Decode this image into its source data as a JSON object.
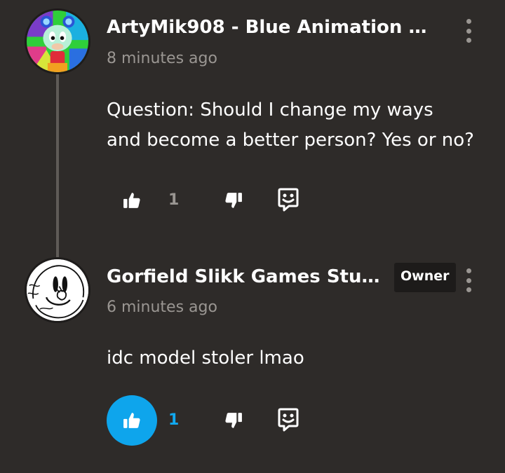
{
  "comments": [
    {
      "author": "ArtyMik908 - Blue Animation",
      "handle": "@...",
      "time": "8 minutes ago",
      "body_line1": "Question: Should I change my ways",
      "body_line2": "and become a better person? Yes or no?",
      "likes": "1",
      "liked": false,
      "avatar_icon": "cartoon-green-character-avatar"
    },
    {
      "author": "Gorfield Slikk Games Stud...",
      "badge": "Owner",
      "time": "6 minutes ago",
      "body_line1": "idc model stoler lmao",
      "likes": "1",
      "liked": true,
      "avatar_icon": "sketch-face-avatar"
    }
  ],
  "icons": {
    "like": "thumbs-up-icon",
    "dislike": "thumbs-down-icon",
    "reply": "reply-speech-icon",
    "menu": "more-vertical-icon"
  },
  "colors": {
    "background": "#2e2b29",
    "accent": "#0ea5ec",
    "muted": "#9a9692"
  }
}
